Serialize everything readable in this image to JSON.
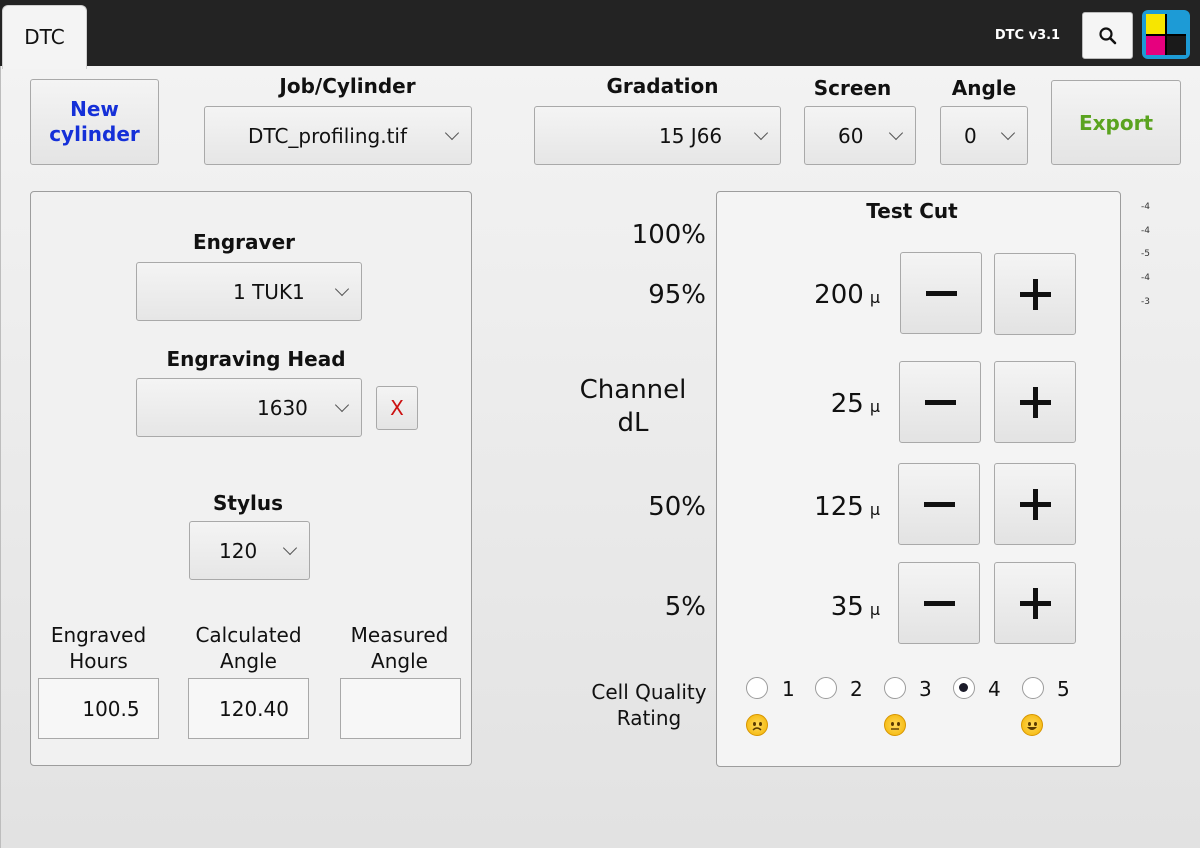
{
  "topbar": {
    "tab_label": "DTC",
    "version": "DTC v3.1",
    "search_icon": "search-icon",
    "logo_colors": [
      "#f7e600",
      "#1d9bd6",
      "#e6007e",
      "#1a1a1a"
    ]
  },
  "toolbar": {
    "new_cylinder_label": "New\ncylinder",
    "job_label": "Job/Cylinder",
    "job_value": "DTC_profiling.tif",
    "gradation_label": "Gradation",
    "gradation_value": "15 J66",
    "screen_label": "Screen",
    "screen_value": "60",
    "angle_label": "Angle",
    "angle_value": "0",
    "export_label": "Export"
  },
  "engraver_panel": {
    "engraver_label": "Engraver",
    "engraver_value": "1 TUK1",
    "head_label": "Engraving Head",
    "head_value": "1630",
    "clear_label": "X",
    "stylus_label": "Stylus",
    "stylus_value": "120",
    "hours_label": "Engraved\nHours",
    "hours_value": "100.5",
    "calc_label": "Calculated\nAngle",
    "calc_value": "120.40",
    "measured_label": "Measured\nAngle",
    "measured_value": ""
  },
  "test_cut": {
    "title": "Test Cut",
    "rows": [
      {
        "label": "100%",
        "value": ""
      },
      {
        "label": "95%",
        "value": "200",
        "unit": "μ"
      },
      {
        "label": "Channel\ndL",
        "value": "25",
        "unit": "μ"
      },
      {
        "label": "50%",
        "value": "125",
        "unit": "μ"
      },
      {
        "label": "5%",
        "value": "35",
        "unit": "μ"
      }
    ],
    "rating_label": "Cell Quality\nRating",
    "ratings": [
      "1",
      "2",
      "3",
      "4",
      "5"
    ],
    "selected_rating": "4"
  },
  "side_values": [
    "-4",
    "-4",
    "-5",
    "-4",
    "-3"
  ],
  "colors": {
    "new_cylinder": "#1530d8",
    "export": "#5aa31f",
    "clear_x": "#cc1111"
  }
}
